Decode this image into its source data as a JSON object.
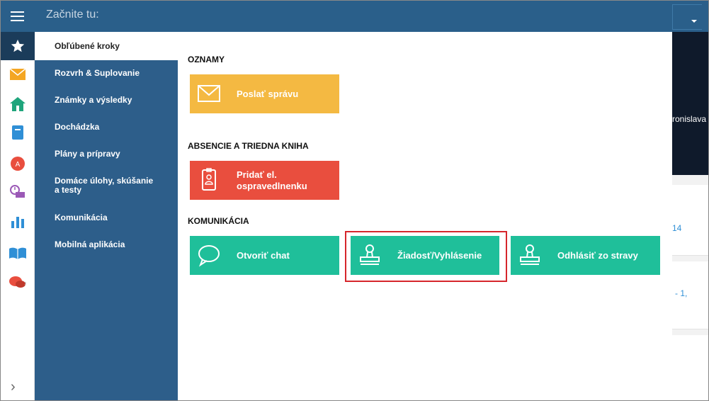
{
  "topbar": {
    "search_placeholder": "Začnite tu:"
  },
  "menu": {
    "items": [
      {
        "label": "Obľúbené kroky"
      },
      {
        "label": "Rozvrh & Suplovanie"
      },
      {
        "label": "Známky a výsledky"
      },
      {
        "label": "Dochádzka"
      },
      {
        "label": "Plány a prípravy"
      },
      {
        "label": "Domáce úlohy, skúšanie a testy"
      },
      {
        "label": "Komunikácia"
      },
      {
        "label": "Mobilná aplikácia"
      }
    ]
  },
  "sections": [
    {
      "title": "OZNAMY",
      "tiles": [
        {
          "label": "Poslať správu",
          "icon": "envelope-icon",
          "color": "#f4b942"
        }
      ]
    },
    {
      "title": "ABSENCIE A TRIEDNA KNIHA",
      "tiles": [
        {
          "label": "Pridať el. ospravedlnenku",
          "icon": "id-badge-icon",
          "color": "#e94e3e"
        }
      ]
    },
    {
      "title": "KOMUNIKÁCIA",
      "tiles": [
        {
          "label": "Otvoriť chat",
          "icon": "chat-bubble-icon",
          "color": "#1fbf9a"
        },
        {
          "label": "Žiadosť/Vyhlásenie",
          "icon": "stamp-icon",
          "color": "#1fbf9a"
        },
        {
          "label": "Odhlásiť zo stravy",
          "icon": "stamp-icon",
          "color": "#1fbf9a"
        }
      ]
    }
  ],
  "background": {
    "name_fragment": "ronislava",
    "link1": "14",
    "link2": "- 1,"
  },
  "colors": {
    "topbar": "#2a5f8a",
    "menu": "#2d5e8a",
    "highlight": "#d6262c"
  }
}
